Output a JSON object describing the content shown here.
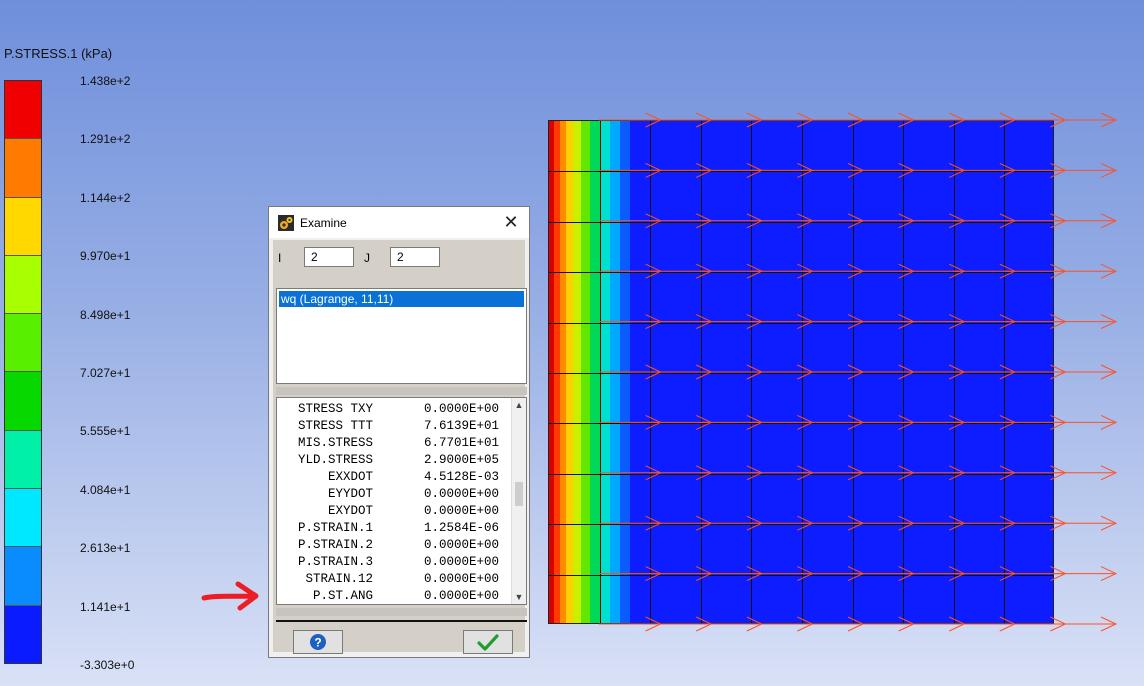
{
  "legend": {
    "title": "P.STRESS.1 (kPa)",
    "labels": [
      "1.438e+2",
      "1.291e+2",
      "1.144e+2",
      "9.970e+1",
      "8.498e+1",
      "7.027e+1",
      "5.555e+1",
      "4.084e+1",
      "2.613e+1",
      "1.141e+1",
      "-3.303e+0"
    ],
    "colors": [
      "#f00000",
      "#ff7a00",
      "#ffd800",
      "#a8ff00",
      "#58f000",
      "#06d800",
      "#00f0a8",
      "#00e8ff",
      "#0a8cff",
      "#0a1cff"
    ]
  },
  "model": {
    "band_colors": [
      "#d80000",
      "#ff3a00",
      "#ff8a00",
      "#ffd000",
      "#c8f000",
      "#60e800",
      "#00d858",
      "#00e0d0",
      "#00a8ff",
      "#0a5cff",
      "#0e1dff"
    ],
    "arrow_color": "#ff5020"
  },
  "dialog": {
    "title": "Examine",
    "i_label": "I",
    "i_value": "2",
    "j_label": "J",
    "j_value": "2",
    "list_items": [
      "wq (Lagrange, 11,11)"
    ],
    "results": [
      {
        "key": "STRESS TXY",
        "value": "0.0000E+00"
      },
      {
        "key": "STRESS TTT",
        "value": "7.6139E+01"
      },
      {
        "key": "MIS.STRESS",
        "value": "6.7701E+01"
      },
      {
        "key": "YLD.STRESS",
        "value": "2.9000E+05"
      },
      {
        "key": "EXXDOT",
        "value": "4.5128E-03"
      },
      {
        "key": "EYYDOT",
        "value": "0.0000E+00"
      },
      {
        "key": "EXYDOT",
        "value": "0.0000E+00"
      },
      {
        "key": "P.STRAIN.1",
        "value": "1.2584E-06"
      },
      {
        "key": "P.STRAIN.2",
        "value": "0.0000E+00"
      },
      {
        "key": "P.STRAIN.3",
        "value": "0.0000E+00"
      },
      {
        "key": "STRAIN.12",
        "value": "0.0000E+00"
      },
      {
        "key": "P.ST.ANG",
        "value": "0.0000E+00"
      }
    ]
  },
  "annotation": {
    "arrow_color": "#ee1c24"
  }
}
